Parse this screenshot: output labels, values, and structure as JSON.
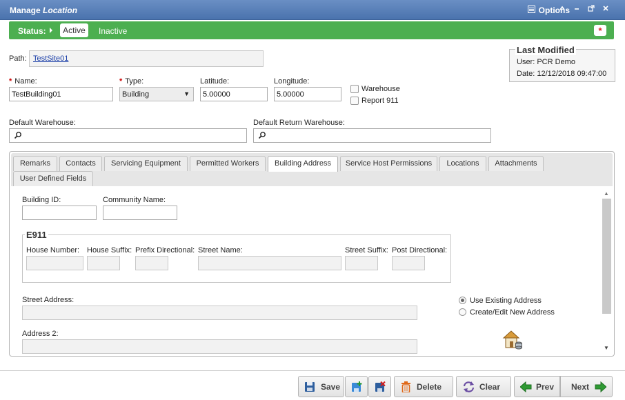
{
  "window": {
    "title_prefix": "Manage",
    "title_italic": "Location",
    "options_label": "Options",
    "controls": [
      "^",
      "–",
      "⤢",
      "✕"
    ]
  },
  "status": {
    "label": "Status:",
    "active": "Active",
    "inactive": "Inactive",
    "required_marker": "*"
  },
  "path": {
    "label": "Path:",
    "value": "TestSite01"
  },
  "last_modified": {
    "heading": "Last Modified",
    "user": "User: PCR Demo",
    "date": "Date: 12/12/2018 09:47:00"
  },
  "fields": {
    "name_label": "Name:",
    "name_value": "TestBuilding01",
    "type_label": "Type:",
    "type_value": "Building",
    "latitude_label": "Latitude:",
    "latitude_value": "5.00000",
    "longitude_label": "Longitude:",
    "longitude_value": "5.00000",
    "warehouse_label": "Warehouse",
    "report911_label": "Report 911",
    "default_warehouse_label": "Default Warehouse:",
    "default_return_warehouse_label": "Default Return Warehouse:"
  },
  "tabs": [
    "Remarks",
    "Contacts",
    "Servicing Equipment",
    "Permitted Workers",
    "Building Address",
    "Service Host Permissions",
    "Locations",
    "Attachments",
    "User Defined Fields"
  ],
  "building_address": {
    "building_id_label": "Building ID:",
    "community_name_label": "Community Name:",
    "e911_legend": "E911",
    "house_number_label": "House Number:",
    "house_suffix_label": "House Suffix:",
    "prefix_directional_label": "Prefix Directional:",
    "street_name_label": "Street Name:",
    "street_suffix_label": "Street Suffix:",
    "post_directional_label": "Post Directional:",
    "street_address_label": "Street Address:",
    "address2_label": "Address 2:",
    "use_existing_label": "Use Existing Address",
    "create_edit_label": "Create/Edit New Address"
  },
  "toolbar": {
    "save": "Save",
    "delete": "Delete",
    "clear": "Clear",
    "prev": "Prev",
    "next": "Next"
  },
  "colors": {
    "titlebar": "#4a73ad",
    "status_green": "#4caf50",
    "link_blue": "#1a3ea8",
    "required_red": "#cc0000"
  }
}
